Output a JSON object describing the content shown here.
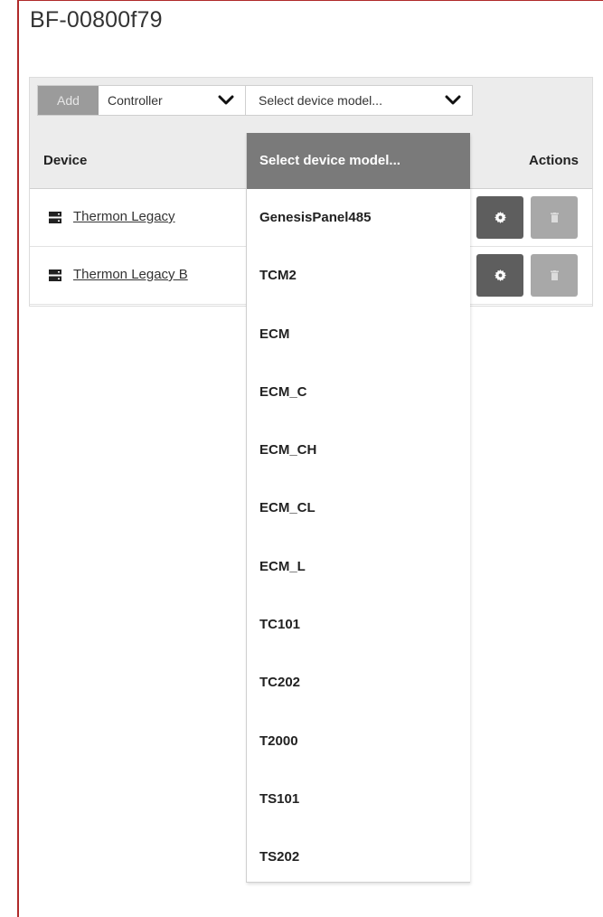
{
  "page": {
    "title": "BF-00800f79"
  },
  "toolbar": {
    "add_label": "Add",
    "device_type_value": "Controller",
    "device_model_value": "Select device model..."
  },
  "table": {
    "headers": {
      "device": "Device",
      "actions": "Actions"
    },
    "rows": [
      {
        "device": "Thermon Legacy"
      },
      {
        "device": "Thermon Legacy B"
      }
    ]
  },
  "dropdown": {
    "header": "Select device model...",
    "options": [
      "GenesisPanel485",
      "TCM2",
      "ECM",
      "ECM_C",
      "ECM_CH",
      "ECM_CL",
      "ECM_L",
      "TC101",
      "TC202",
      "T2000",
      "TS101",
      "TS202"
    ]
  },
  "icons": {
    "device": "server-icon",
    "configure": "gear-icon",
    "delete": "trash-icon",
    "select_arrow": "chevron-down-icon"
  },
  "colors": {
    "frame_border": "#b02a2a",
    "header_bg": "#ececec",
    "dropdown_header_bg": "#7a7a7a",
    "config_button": "#5e5e5e",
    "delete_button": "#a8a8a8",
    "add_button": "#9b9b9b"
  }
}
